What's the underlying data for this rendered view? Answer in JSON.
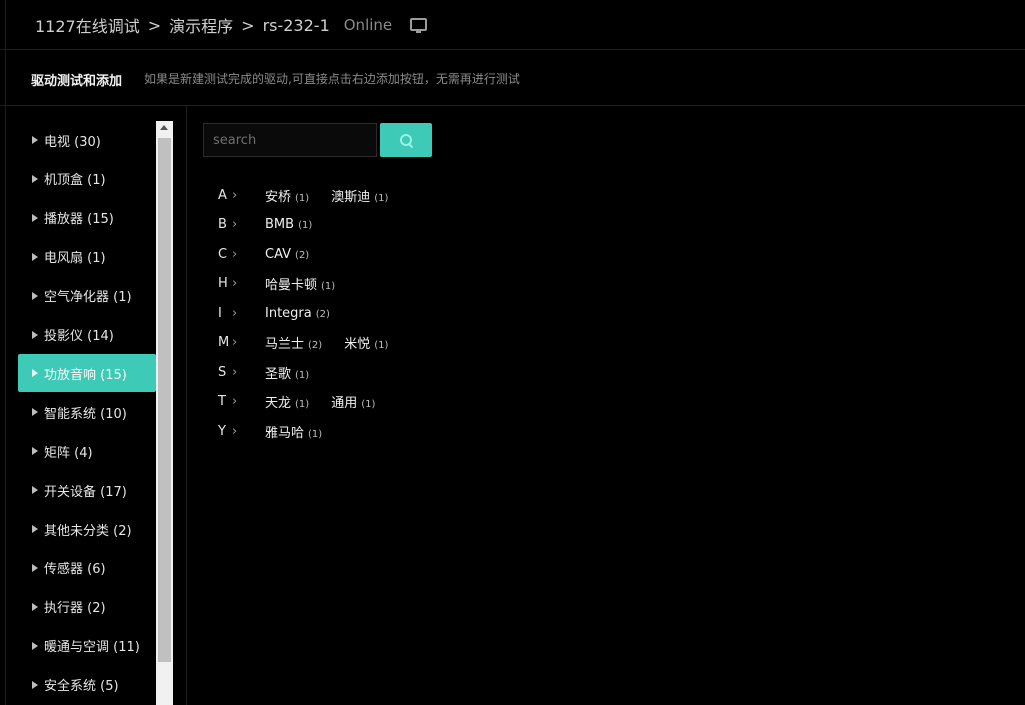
{
  "breadcrumb": {
    "items": [
      "1127在线调试",
      "演示程序",
      "rs-232-1"
    ],
    "separator": ">"
  },
  "status": "Online",
  "info": {
    "title": "驱动测试和添加",
    "description": "如果是新建测试完成的驱动,可直接点击右边添加按钮，无需再进行测试"
  },
  "categories": [
    {
      "label": "电视 (30)"
    },
    {
      "label": "机顶盒 (1)"
    },
    {
      "label": "播放器 (15)"
    },
    {
      "label": "电风扇 (1)"
    },
    {
      "label": "空气净化器 (1)"
    },
    {
      "label": "投影仪 (14)"
    },
    {
      "label": "功放音响 (15)",
      "active": true
    },
    {
      "label": "智能系统 (10)"
    },
    {
      "label": "矩阵 (4)"
    },
    {
      "label": "开关设备 (17)"
    },
    {
      "label": "其他未分类 (2)"
    },
    {
      "label": "传感器 (6)"
    },
    {
      "label": "执行器 (2)"
    },
    {
      "label": "暖通与空调 (11)"
    },
    {
      "label": "安全系统 (5)"
    }
  ],
  "search": {
    "placeholder": "search",
    "value": ""
  },
  "brand_groups": [
    {
      "letter": "A",
      "brands": [
        {
          "name": "安桥",
          "count": "(1)"
        },
        {
          "name": "澳斯迪",
          "count": "(1)"
        }
      ]
    },
    {
      "letter": "B",
      "brands": [
        {
          "name": "BMB",
          "count": "(1)"
        }
      ]
    },
    {
      "letter": "C",
      "brands": [
        {
          "name": "CAV",
          "count": "(2)"
        }
      ]
    },
    {
      "letter": "H",
      "brands": [
        {
          "name": "哈曼卡顿",
          "count": "(1)"
        }
      ]
    },
    {
      "letter": "I",
      "brands": [
        {
          "name": "Integra",
          "count": "(2)"
        }
      ]
    },
    {
      "letter": "M",
      "brands": [
        {
          "name": "马兰士",
          "count": "(2)"
        },
        {
          "name": "米悦",
          "count": "(1)"
        }
      ]
    },
    {
      "letter": "S",
      "brands": [
        {
          "name": "圣歌",
          "count": "(1)"
        }
      ]
    },
    {
      "letter": "T",
      "brands": [
        {
          "name": "天龙",
          "count": "(1)"
        },
        {
          "name": "通用",
          "count": "(1)"
        }
      ]
    },
    {
      "letter": "Y",
      "brands": [
        {
          "name": "雅马哈",
          "count": "(1)"
        }
      ]
    }
  ],
  "colors": {
    "accent": "#3dcab6",
    "background": "#000000"
  }
}
